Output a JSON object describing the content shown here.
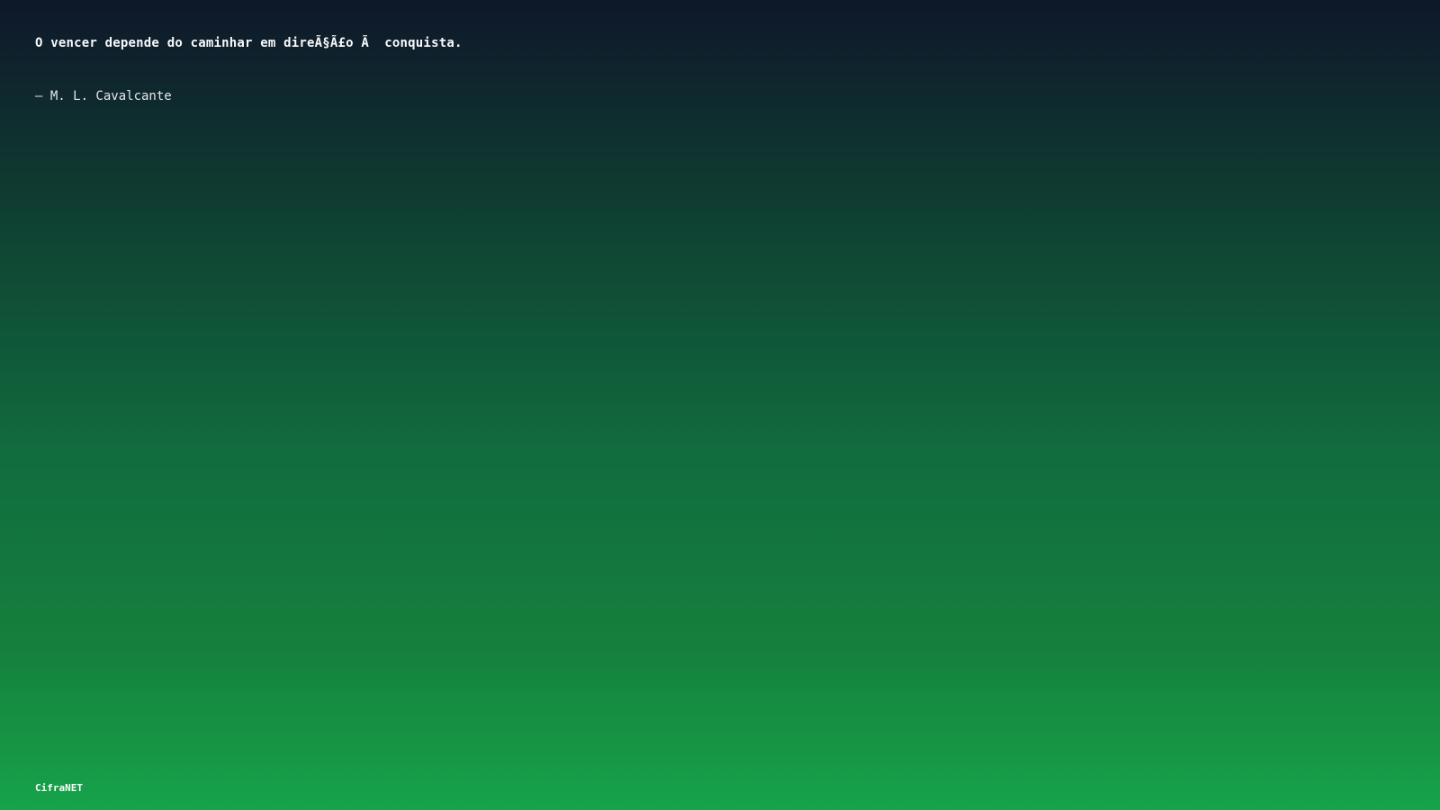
{
  "quote": {
    "text": "O vencer depende do caminhar em direÃ§Ã£o Ã  conquista.",
    "author": "– M. L. Cavalcante"
  },
  "brand": {
    "name": "CifraNET"
  },
  "colors": {
    "gradient_top": "#0f172a",
    "gradient_bottom": "#16a34a",
    "text": "#ffffff"
  }
}
